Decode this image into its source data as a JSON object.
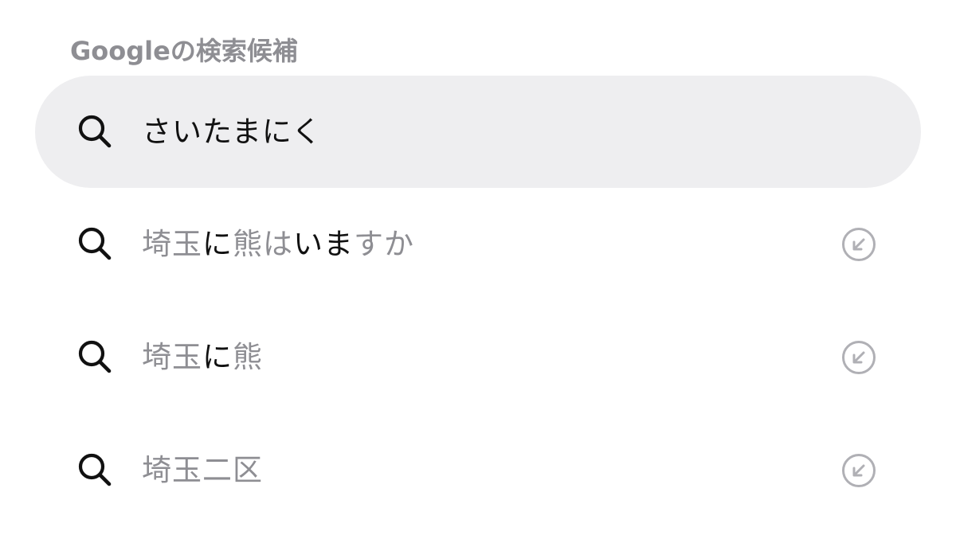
{
  "section": {
    "title": "Googleの検索候補"
  },
  "top_hit": {
    "text": "さいたまにく",
    "icon": "search-icon"
  },
  "suggestions": [
    {
      "segments": [
        {
          "text": "埼玉",
          "hl": false
        },
        {
          "text": "に",
          "hl": true
        },
        {
          "text": "熊",
          "hl": false
        },
        {
          "text": "は",
          "hl": false
        },
        {
          "text": "いま",
          "hl": true
        },
        {
          "text": "すか",
          "hl": false
        }
      ],
      "icon": "search-icon",
      "action_icon": "arrow-up-left-circle-icon"
    },
    {
      "segments": [
        {
          "text": "埼玉",
          "hl": false
        },
        {
          "text": "に",
          "hl": true
        },
        {
          "text": "熊",
          "hl": false
        }
      ],
      "icon": "search-icon",
      "action_icon": "arrow-up-left-circle-icon"
    },
    {
      "segments": [
        {
          "text": "埼玉二区",
          "hl": false
        }
      ],
      "icon": "search-icon",
      "action_icon": "arrow-up-left-circle-icon"
    }
  ],
  "colors": {
    "header_text": "#8e8e93",
    "highlight_bg": "#eeeef0",
    "primary_text": "#111111",
    "secondary_text": "#8e8e93",
    "fill_icon": "#b0b0b5"
  }
}
